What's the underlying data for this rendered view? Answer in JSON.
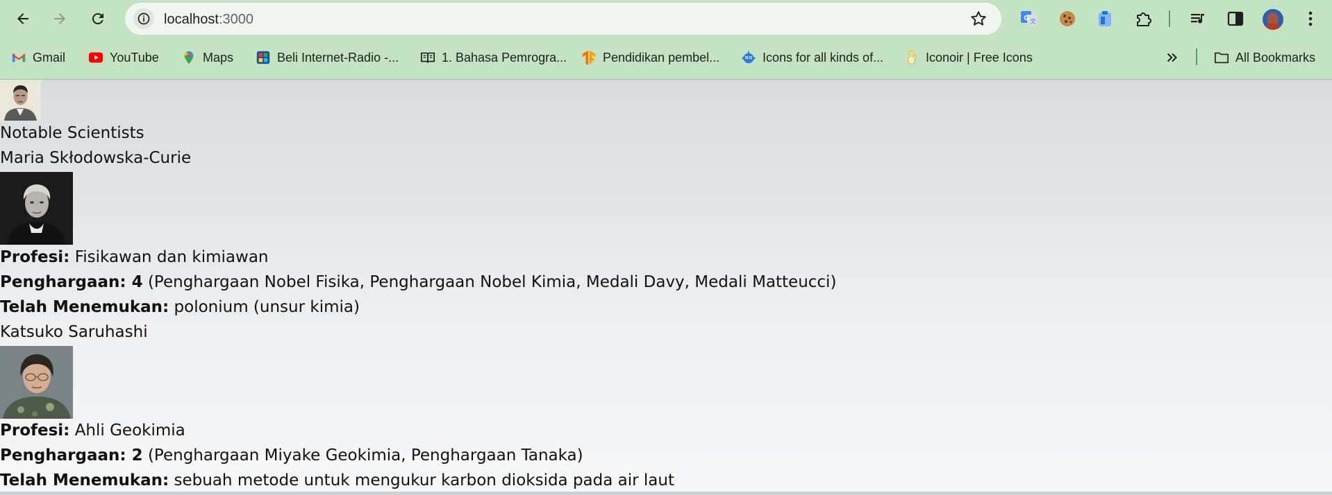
{
  "browser": {
    "url_host": "localhost",
    "url_port": ":3000",
    "bookmarks": [
      {
        "label": "Gmail",
        "icon": "gmail-icon"
      },
      {
        "label": "YouTube",
        "icon": "youtube-icon"
      },
      {
        "label": "Maps",
        "icon": "maps-icon"
      },
      {
        "label": "Beli Internet-Radio -...",
        "icon": "radio-store-icon"
      },
      {
        "label": "1. Bahasa Pemrogra...",
        "icon": "book-icon"
      },
      {
        "label": "Pendidikan pembel...",
        "icon": "tensorflow-icon"
      },
      {
        "label": "Icons for all kinds of...",
        "icon": "robot-icon"
      },
      {
        "label": "Iconoir | Free Icons",
        "icon": "peace-hand-icon"
      }
    ],
    "all_bookmarks_label": "All Bookmarks"
  },
  "page": {
    "heading": "Notable Scientists",
    "scientists": [
      {
        "name": "Maria Skłodowska-Curie",
        "profession_label": "Profesi:",
        "profession": "Fisikawan dan kimiawan",
        "awards_label": "Penghargaan: 4",
        "awards": "(Penghargaan Nobel Fisika, Penghargaan Nobel Kimia, Medali Davy, Medali Matteucci)",
        "discovery_label": "Telah Menemukan:",
        "discovery": "polonium (unsur kimia)"
      },
      {
        "name": "Katsuko Saruhashi",
        "profession_label": "Profesi:",
        "profession": "Ahli Geokimia",
        "awards_label": "Penghargaan: 2",
        "awards": "(Penghargaan Miyake Geokimia, Penghargaan Tanaka)",
        "discovery_label": "Telah Menemukan:",
        "discovery": "sebuah metode untuk mengukur karbon dioksida pada air laut"
      }
    ]
  }
}
